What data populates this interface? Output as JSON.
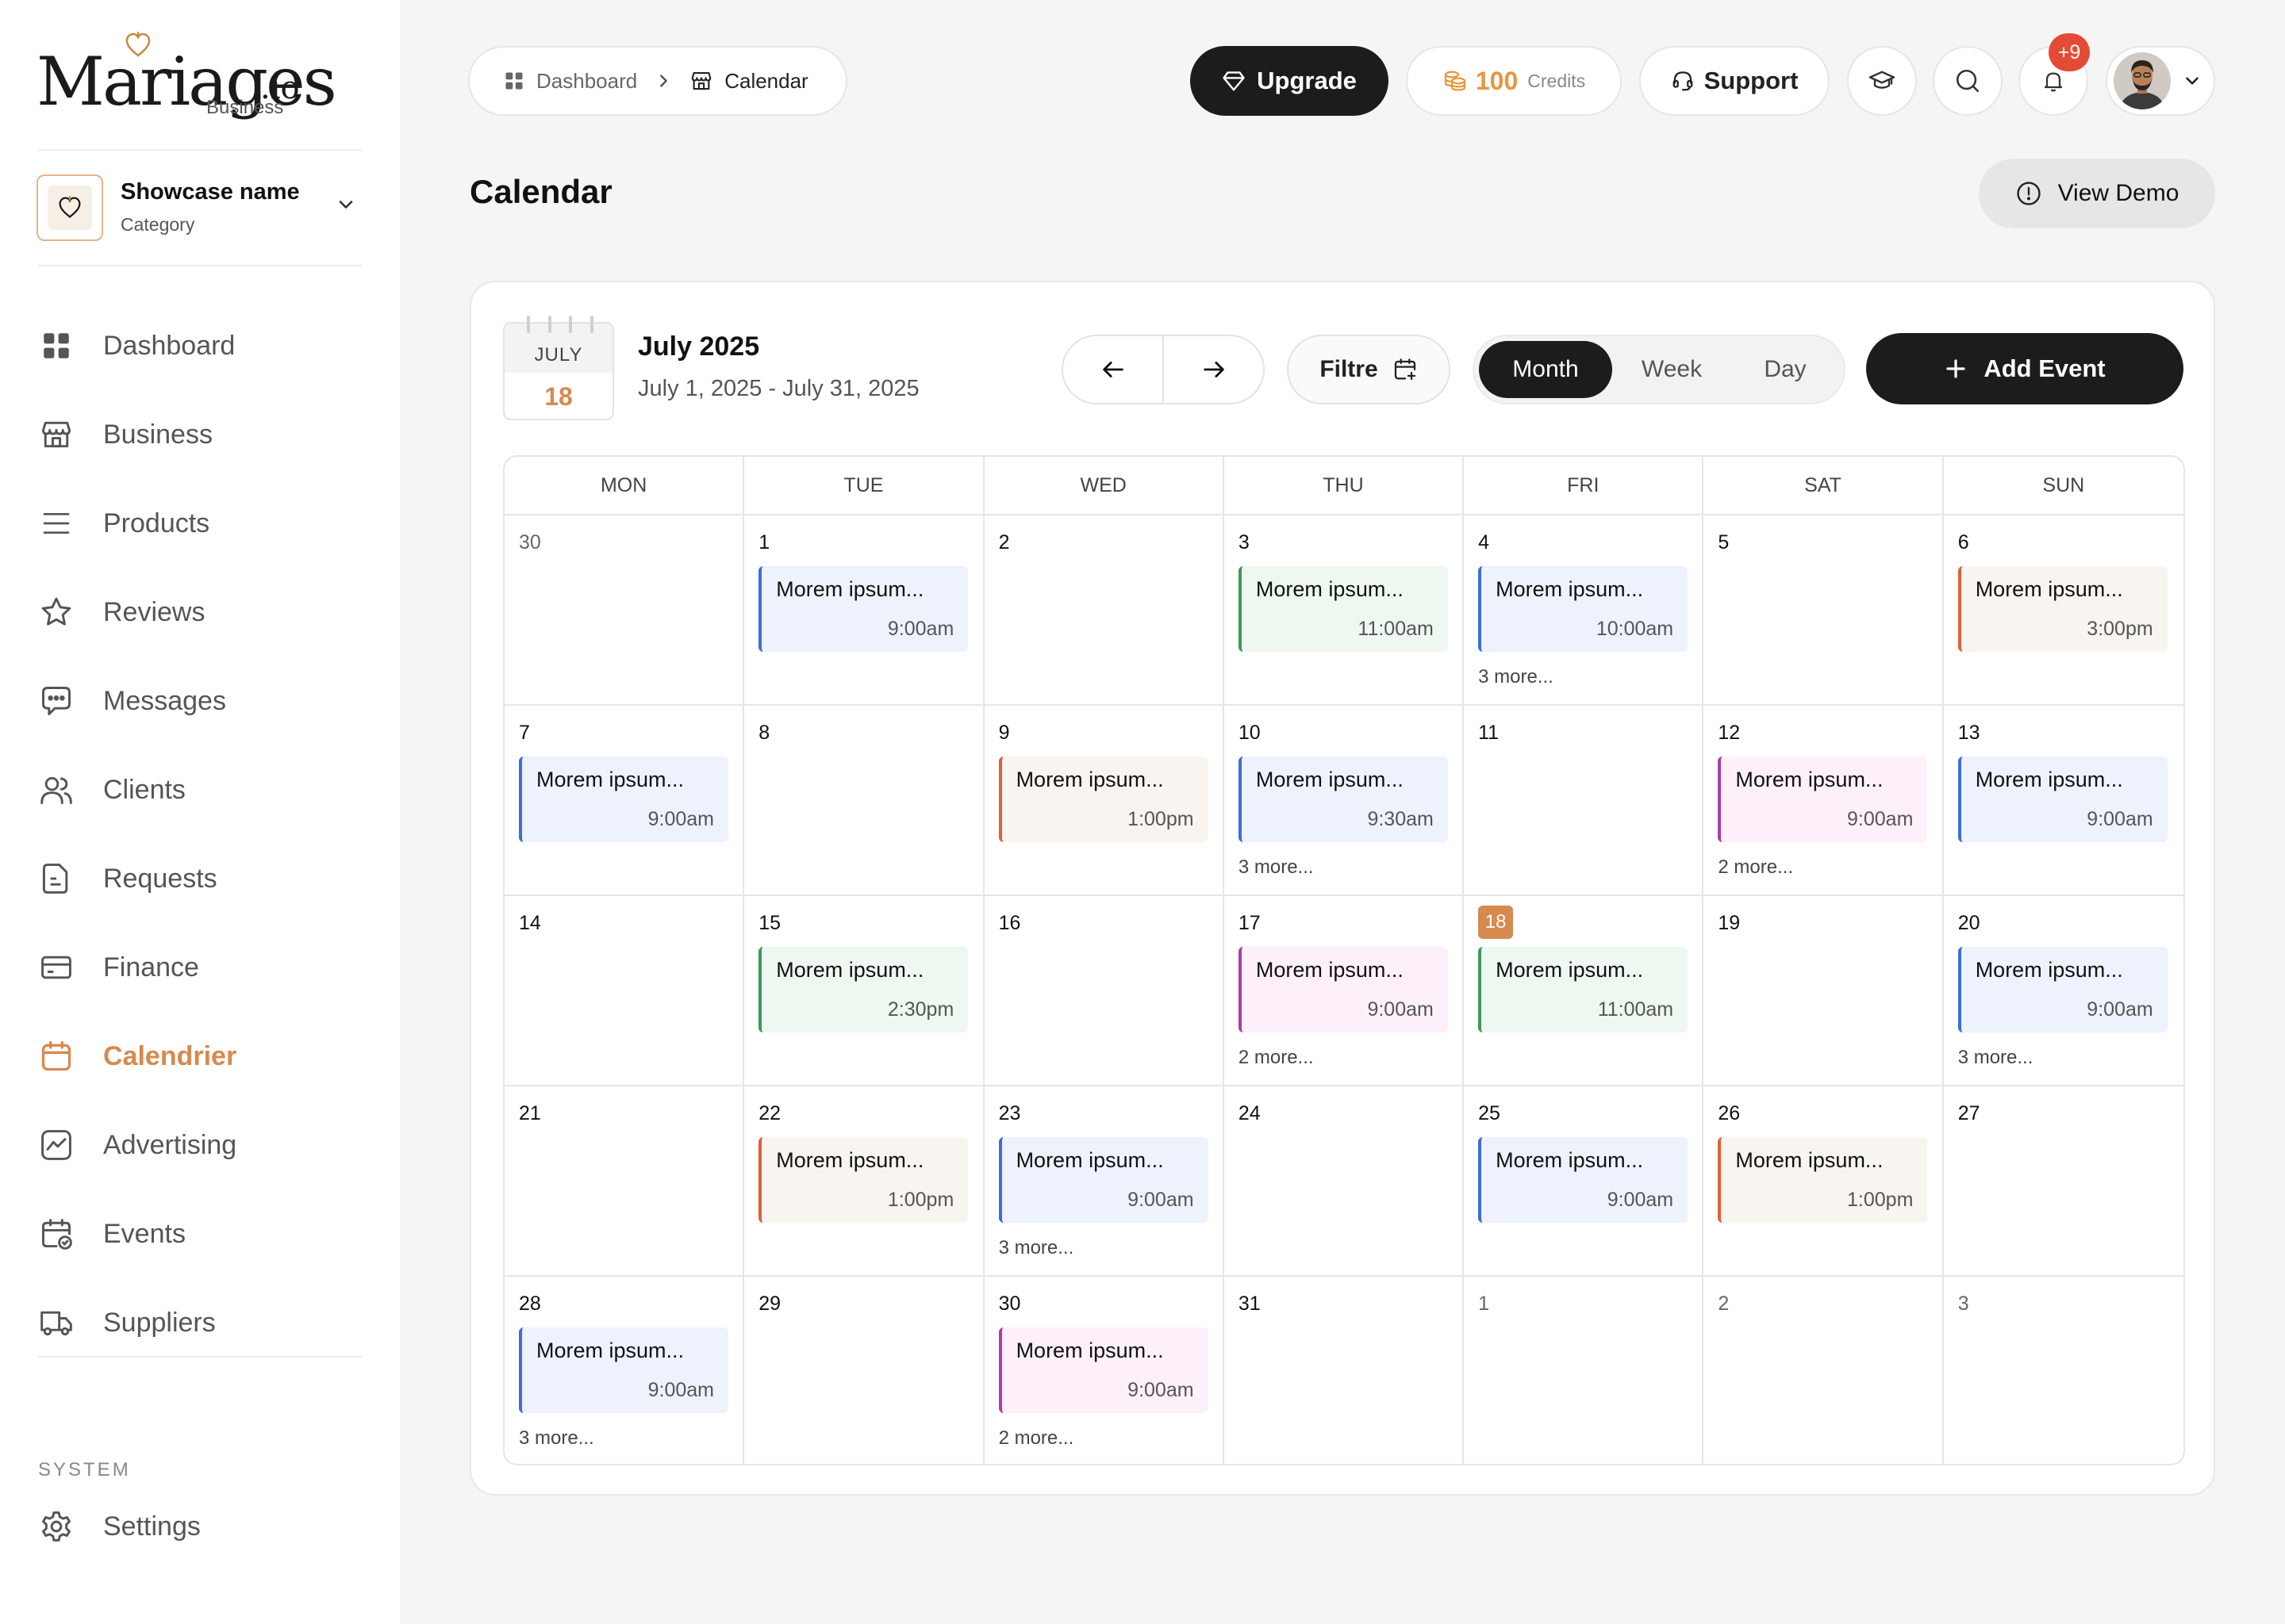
{
  "sidebar": {
    "logo": {
      "word": "Mariages",
      "suffix": ".io",
      "sub": "Business"
    },
    "showcase": {
      "name": "Showcase name",
      "category": "Category"
    },
    "nav": [
      {
        "id": "dashboard",
        "label": "Dashboard",
        "icon": "dashboard-icon"
      },
      {
        "id": "business",
        "label": "Business",
        "icon": "store-icon"
      },
      {
        "id": "products",
        "label": "Products",
        "icon": "menu-lines-icon"
      },
      {
        "id": "reviews",
        "label": "Reviews",
        "icon": "star-icon"
      },
      {
        "id": "messages",
        "label": "Messages",
        "icon": "chat-icon"
      },
      {
        "id": "clients",
        "label": "Clients",
        "icon": "users-icon"
      },
      {
        "id": "requests",
        "label": "Requests",
        "icon": "document-icon"
      },
      {
        "id": "finance",
        "label": "Finance",
        "icon": "card-icon"
      },
      {
        "id": "calendrier",
        "label": "Calendrier",
        "icon": "calendar-icon",
        "active": true
      },
      {
        "id": "advertising",
        "label": "Advertising",
        "icon": "trend-icon"
      },
      {
        "id": "events",
        "label": "Events",
        "icon": "calendar-check-icon"
      },
      {
        "id": "suppliers",
        "label": "Suppliers",
        "icon": "truck-icon"
      }
    ],
    "system_label": "SYSTEM",
    "settings_label": "Settings"
  },
  "topbar": {
    "breadcrumb": [
      "Dashboard",
      "Calendar"
    ],
    "upgrade_label": "Upgrade",
    "credits_value": "100",
    "credits_label": "Credits",
    "support_label": "Support",
    "notification_badge": "+9"
  },
  "page": {
    "title": "Calendar",
    "view_demo_label": "View Demo"
  },
  "calendar": {
    "datebox_month": "JULY",
    "datebox_day": "18",
    "month_title": "July 2025",
    "range": "July 1, 2025 - July 31, 2025",
    "filter_label": "Filtre",
    "views": [
      "Month",
      "Week",
      "Day"
    ],
    "active_view": "Month",
    "add_event_label": "Add Event",
    "weekdays": [
      "MON",
      "TUE",
      "WED",
      "THU",
      "FRI",
      "SAT",
      "SUN"
    ],
    "event_colors": {
      "blue": {
        "border": "#3b6fd8",
        "bg": "#eef2fd"
      },
      "green": {
        "border": "#3a9a5b",
        "bg": "#eef8f1"
      },
      "orange": {
        "border": "#e0603a",
        "bg": "#f8f5f0"
      },
      "pink": {
        "border": "#b03aa6",
        "bg": "#fdf0fb"
      }
    },
    "weeks": [
      [
        {
          "day": "30",
          "muted": true
        },
        {
          "day": "1",
          "event": {
            "title": "Morem ipsum...",
            "time": "9:00am",
            "color": "blue"
          }
        },
        {
          "day": "2"
        },
        {
          "day": "3",
          "event": {
            "title": "Morem ipsum...",
            "time": "11:00am",
            "color": "green"
          }
        },
        {
          "day": "4",
          "event": {
            "title": "Morem ipsum...",
            "time": "10:00am",
            "color": "blue"
          },
          "more": "3 more..."
        },
        {
          "day": "5"
        },
        {
          "day": "6",
          "event": {
            "title": "Morem ipsum...",
            "time": "3:00pm",
            "color": "orange"
          }
        }
      ],
      [
        {
          "day": "7",
          "event": {
            "title": "Morem ipsum...",
            "time": "9:00am",
            "color": "blue"
          }
        },
        {
          "day": "8"
        },
        {
          "day": "9",
          "event": {
            "title": "Morem ipsum...",
            "time": "1:00pm",
            "color": "orange"
          }
        },
        {
          "day": "10",
          "event": {
            "title": "Morem ipsum...",
            "time": "9:30am",
            "color": "blue"
          },
          "more": "3 more..."
        },
        {
          "day": "11"
        },
        {
          "day": "12",
          "event": {
            "title": "Morem ipsum...",
            "time": "9:00am",
            "color": "pink"
          },
          "more": "2 more..."
        },
        {
          "day": "13",
          "event": {
            "title": "Morem ipsum...",
            "time": "9:00am",
            "color": "blue"
          }
        }
      ],
      [
        {
          "day": "14"
        },
        {
          "day": "15",
          "event": {
            "title": "Morem ipsum...",
            "time": "2:30pm",
            "color": "green"
          }
        },
        {
          "day": "16"
        },
        {
          "day": "17",
          "event": {
            "title": "Morem ipsum...",
            "time": "9:00am",
            "color": "pink"
          },
          "more": "2 more..."
        },
        {
          "day": "18",
          "today": true,
          "event": {
            "title": "Morem ipsum...",
            "time": "11:00am",
            "color": "green"
          }
        },
        {
          "day": "19"
        },
        {
          "day": "20",
          "event": {
            "title": "Morem ipsum...",
            "time": "9:00am",
            "color": "blue"
          },
          "more": "3 more..."
        }
      ],
      [
        {
          "day": "21"
        },
        {
          "day": "22",
          "event": {
            "title": "Morem ipsum...",
            "time": "1:00pm",
            "color": "orange"
          }
        },
        {
          "day": "23",
          "event": {
            "title": "Morem ipsum...",
            "time": "9:00am",
            "color": "blue"
          },
          "more": "3 more..."
        },
        {
          "day": "24"
        },
        {
          "day": "25",
          "event": {
            "title": "Morem ipsum...",
            "time": "9:00am",
            "color": "blue"
          }
        },
        {
          "day": "26",
          "event": {
            "title": "Morem ipsum...",
            "time": "1:00pm",
            "color": "orange"
          }
        },
        {
          "day": "27"
        }
      ],
      [
        {
          "day": "28",
          "event": {
            "title": "Morem ipsum...",
            "time": "9:00am",
            "color": "blue"
          },
          "more": "3 more..."
        },
        {
          "day": "29"
        },
        {
          "day": "30",
          "event": {
            "title": "Morem ipsum...",
            "time": "9:00am",
            "color": "pink"
          },
          "more": "2 more..."
        },
        {
          "day": "31"
        },
        {
          "day": "1",
          "muted": true
        },
        {
          "day": "2",
          "muted": true
        },
        {
          "day": "3",
          "muted": true
        }
      ]
    ]
  }
}
